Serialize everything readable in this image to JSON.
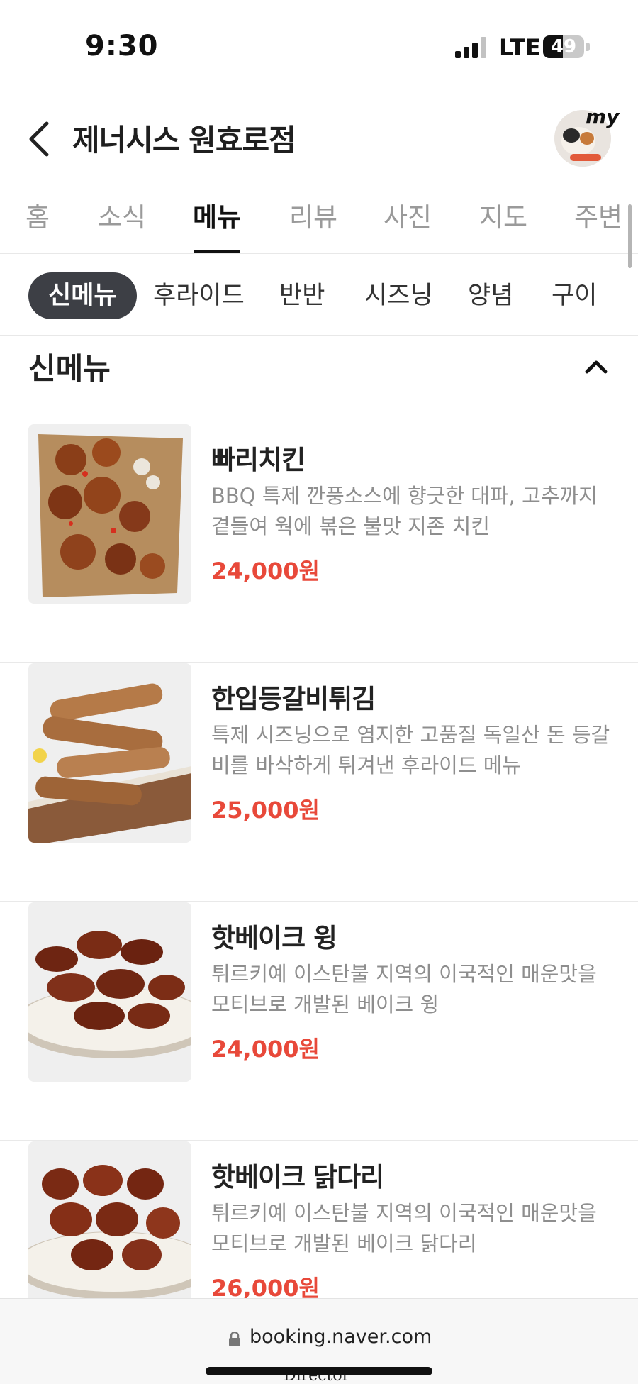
{
  "status_bar": {
    "time": "9:30",
    "network": "LTE",
    "battery": "49",
    "battery_level": 0.49
  },
  "header": {
    "title": "제너시스 원효로점",
    "avatar_badge": "my"
  },
  "tabs": [
    {
      "label": "홈"
    },
    {
      "label": "소식"
    },
    {
      "label": "메뉴"
    },
    {
      "label": "리뷰"
    },
    {
      "label": "사진"
    },
    {
      "label": "지도"
    },
    {
      "label": "주변"
    }
  ],
  "active_tab": "메뉴",
  "categories": [
    {
      "label": "신메뉴"
    },
    {
      "label": "후라이드"
    },
    {
      "label": "반반"
    },
    {
      "label": "시즈닝"
    },
    {
      "label": "양념"
    },
    {
      "label": "구이"
    }
  ],
  "active_category": "신메뉴",
  "section": {
    "title": "신메뉴"
  },
  "menu_items": [
    {
      "name": "빠리치킨",
      "description": "BBQ 특제 깐풍소스에 향긋한 대파, 고추까지 곁들여 웍에 볶은 불맛 지존 치킨",
      "price": "24,000원"
    },
    {
      "name": "한입등갈비튀김",
      "description": "특제 시즈닝으로 염지한 고품질 독일산 돈 등갈비를 바삭하게 튀겨낸 후라이드 메뉴",
      "price": "25,000원"
    },
    {
      "name": "핫베이크 윙",
      "description": "튀르키예 이스탄불 지역의 이국적인 매운맛을 모티브로 개발된 베이크 윙",
      "price": "24,000원"
    },
    {
      "name": "핫베이크 닭다리",
      "description": "튀르키예 이스탄불 지역의 이국적인 매운맛을 모티브로 개발된 베이크 닭다리",
      "price": "26,000원"
    }
  ],
  "browser": {
    "url": "booking.naver.com",
    "overlay_text": "Director"
  },
  "colors": {
    "price": "#e8493a",
    "chip_active_bg": "#3d3f45",
    "tab_inactive": "#9a9a9a",
    "description": "#8e8e8e"
  },
  "icons": {
    "back": "chevron-left-icon",
    "collapse": "chevron-up-icon",
    "lock": "lock-icon"
  }
}
